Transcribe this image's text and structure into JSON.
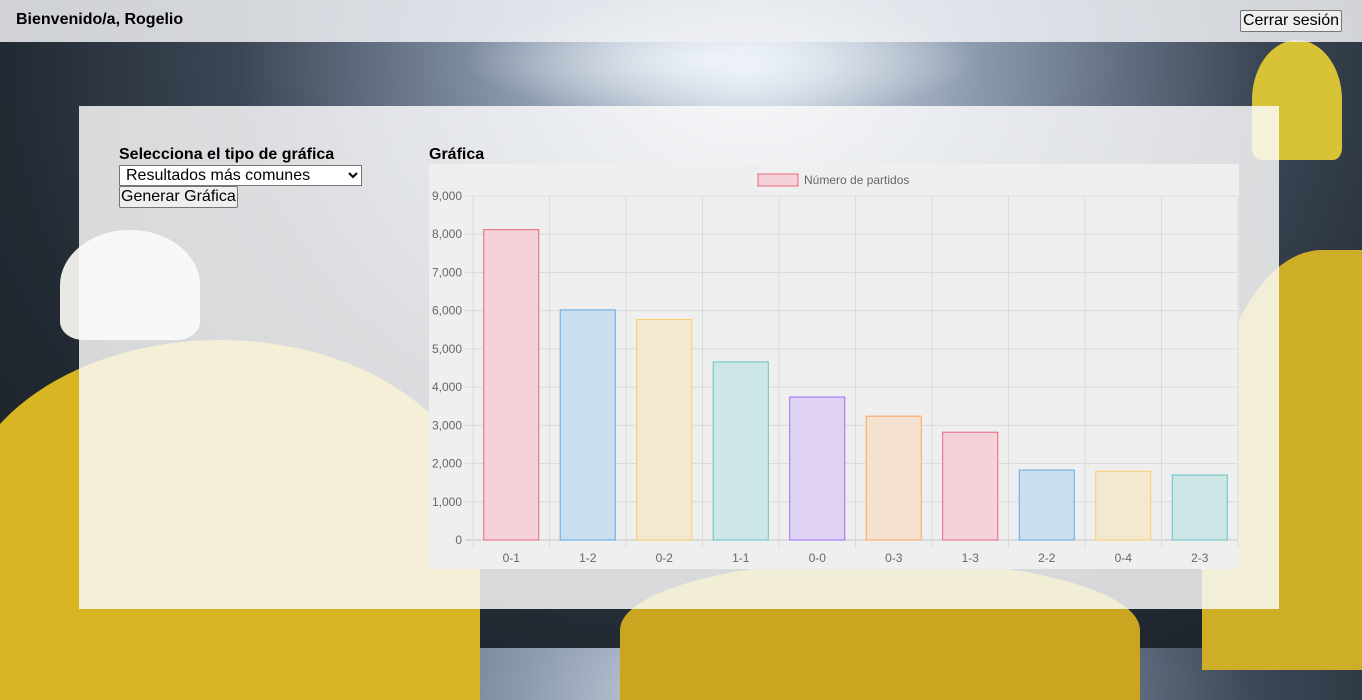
{
  "header": {
    "welcome": "Bienvenido/a, Rogelio",
    "logout_label": "Cerrar sesión"
  },
  "controls": {
    "label": "Selecciona el tipo de gráfica",
    "selected_option": "Resultados más comunes",
    "generate_label": "Generar Gráfica"
  },
  "chart_section": {
    "title": "Gráfica"
  },
  "colors": {
    "fills": [
      "#f5d2d9",
      "#c9dff0",
      "#f4e8d1",
      "#cde6e6",
      "#dfd2f4",
      "#f5e1cf"
    ],
    "strokes": [
      "#e5677f",
      "#5eaae6",
      "#f8cd69",
      "#67c3c3",
      "#9f6bf7",
      "#fda25b"
    ]
  },
  "chart_data": {
    "type": "bar",
    "categories": [
      "0-1",
      "1-2",
      "0-2",
      "1-1",
      "0-0",
      "0-3",
      "1-3",
      "2-2",
      "0-4",
      "2-3"
    ],
    "series": [
      {
        "name": "Número de partidos",
        "values": [
          8120,
          6020,
          5770,
          4660,
          3740,
          3240,
          2820,
          1830,
          1800,
          1700
        ]
      }
    ],
    "ylim": [
      0,
      9000
    ],
    "yticks": [
      "0",
      "1,000",
      "2,000",
      "3,000",
      "4,000",
      "5,000",
      "6,000",
      "7,000",
      "8,000",
      "9,000"
    ],
    "grid": true,
    "legend_position": "top"
  }
}
